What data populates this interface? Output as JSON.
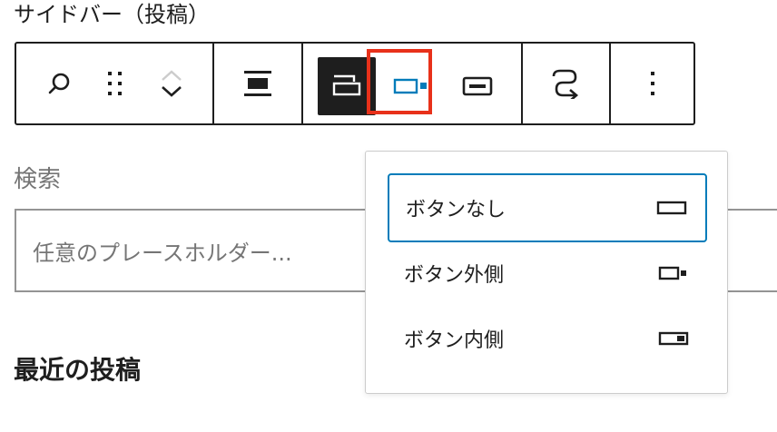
{
  "sidebar": {
    "title": "サイドバー（投稿）"
  },
  "toolbar": {
    "groups": [
      {
        "name": "block-tools",
        "items": [
          "search-icon",
          "drag-handle-icon",
          "move-up-icon",
          "move-down-icon"
        ]
      },
      {
        "name": "alignment",
        "items": [
          "align-wide-icon"
        ]
      },
      {
        "name": "button-position",
        "items": [
          "button-none-icon",
          "button-outside-icon",
          "button-inside-icon"
        ],
        "active": "button-none-icon",
        "highlighted": "button-outside-icon"
      },
      {
        "name": "transform",
        "items": [
          "transform-icon"
        ]
      },
      {
        "name": "options",
        "items": [
          "more-options-icon"
        ]
      }
    ],
    "colors": {
      "border": "#1e1e1e",
      "active_bg": "#1e1e1e",
      "accent": "#007cba",
      "highlight": "#e8311a"
    }
  },
  "search_block": {
    "heading": "検索",
    "placeholder": "任意のプレースホルダー..."
  },
  "recent_posts": {
    "heading": "最近の投稿"
  },
  "dropdown": {
    "options": [
      {
        "label": "ボタンなし",
        "icon": "button-none-icon",
        "selected": true
      },
      {
        "label": "ボタン外側",
        "icon": "button-outside-icon",
        "selected": false
      },
      {
        "label": "ボタン内側",
        "icon": "button-inside-icon",
        "selected": false
      }
    ]
  }
}
